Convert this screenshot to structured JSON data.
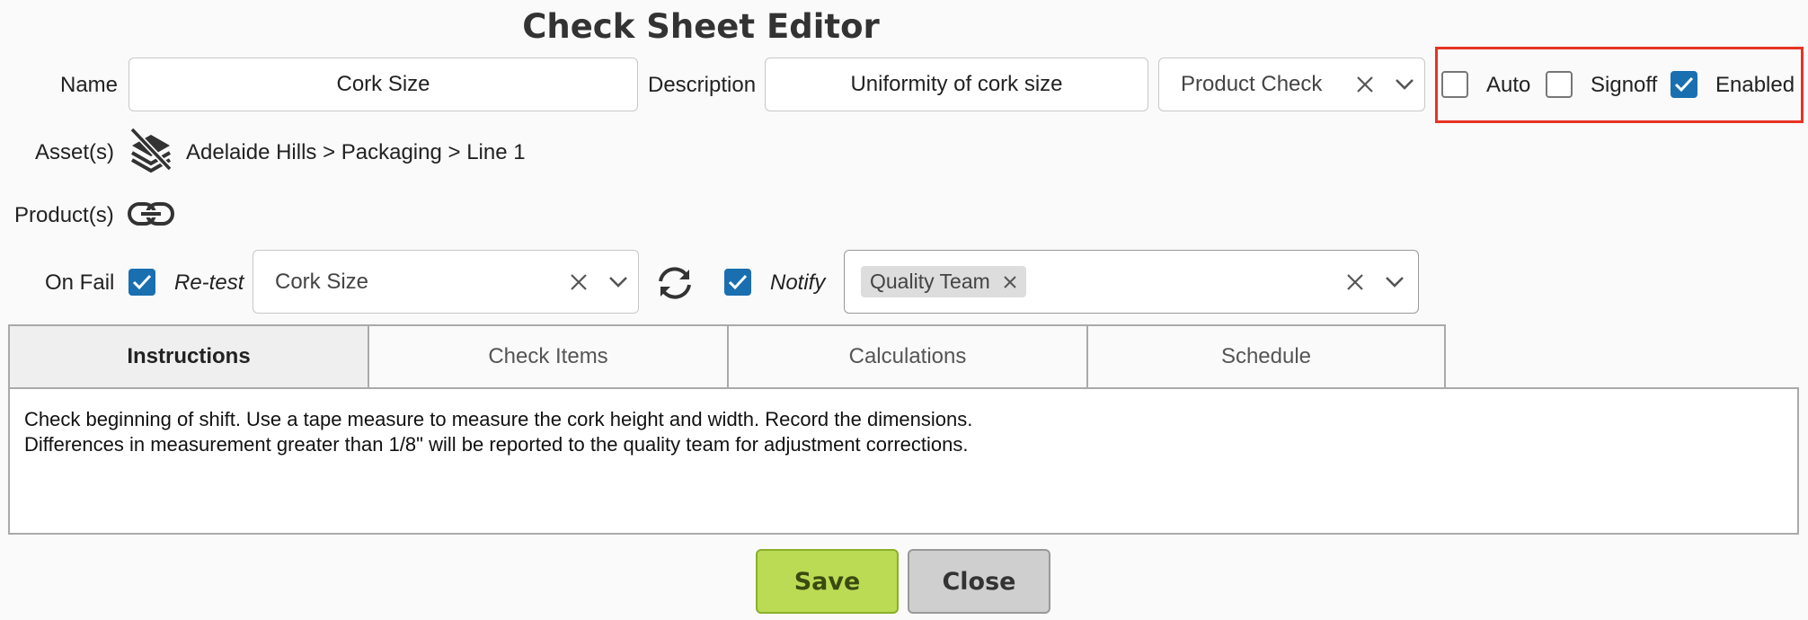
{
  "window": {
    "title": "Check Sheet Editor"
  },
  "form": {
    "name_label": "Name",
    "name_value": "Cork Size",
    "description_label": "Description",
    "description_value": "Uniformity of cork size",
    "type_value": "Product Check",
    "auto_label": "Auto",
    "auto_checked": false,
    "signoff_label": "Signoff",
    "signoff_checked": false,
    "enabled_label": "Enabled",
    "enabled_checked": true,
    "assets_label": "Asset(s)",
    "assets_value": "Adelaide Hills > Packaging > Line 1",
    "products_label": "Product(s)",
    "onfail_label": "On Fail",
    "onfail_checked": true,
    "retest_label": "Re-test",
    "retest_value": "Cork Size",
    "notify_checked": true,
    "notify_label": "Notify",
    "notify_tags": [
      "Quality Team"
    ]
  },
  "tabs": [
    "Instructions",
    "Check Items",
    "Calculations",
    "Schedule"
  ],
  "active_tab": "Instructions",
  "instructions": {
    "line1": "Check beginning of shift. Use a tape measure to measure the cork height and width. Record the dimensions.",
    "line2": "Differences in measurement greater than 1/8\" will be reported to the quality team for adjustment corrections."
  },
  "buttons": {
    "save": "Save",
    "close": "Close"
  },
  "colors": {
    "accent": "#1a6fb0",
    "save_bg": "#bcdb54",
    "highlight": "#e63323"
  },
  "icons": [
    "unlink-layers-icon",
    "link-icon",
    "refresh-icon",
    "clear-icon",
    "chevron-down-icon",
    "check-icon"
  ]
}
